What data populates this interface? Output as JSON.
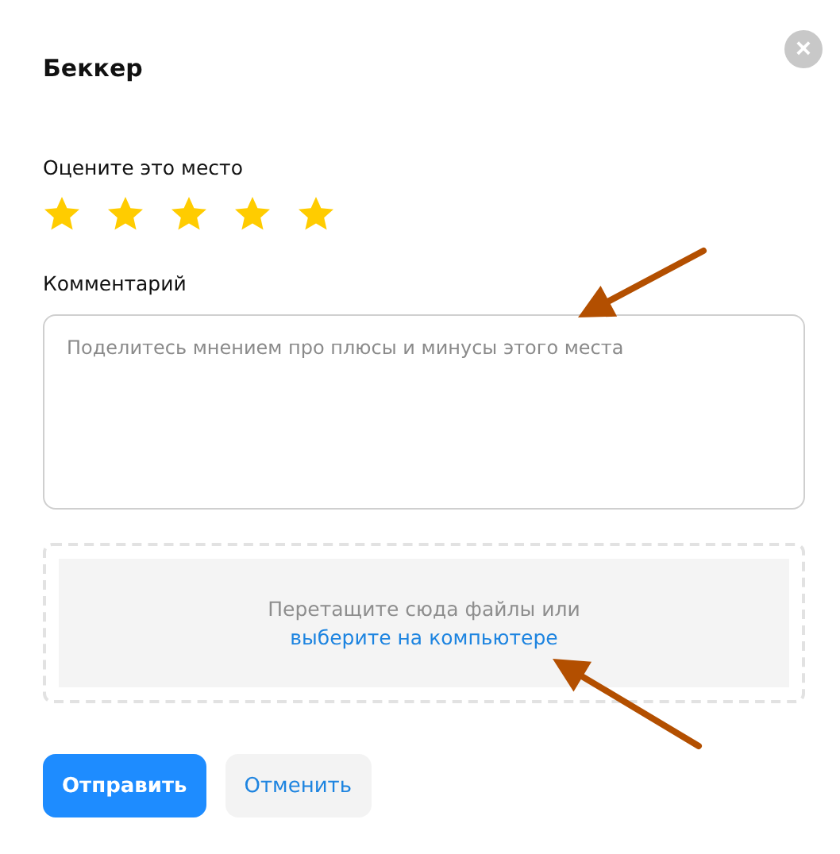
{
  "dialog": {
    "title": "Беккер",
    "close_label": "×"
  },
  "rating": {
    "label": "Оцените это место",
    "stars": 5
  },
  "comment": {
    "label": "Комментарий",
    "placeholder": "Поделитесь мнением про плюсы и минусы этого места"
  },
  "upload": {
    "hint": "Перетащите сюда файлы или",
    "link": "выберите на компьютере"
  },
  "buttons": [
    {
      "label": "Отправить",
      "kind": "primary"
    },
    {
      "label": "Отменить",
      "kind": "secondary"
    }
  ]
}
